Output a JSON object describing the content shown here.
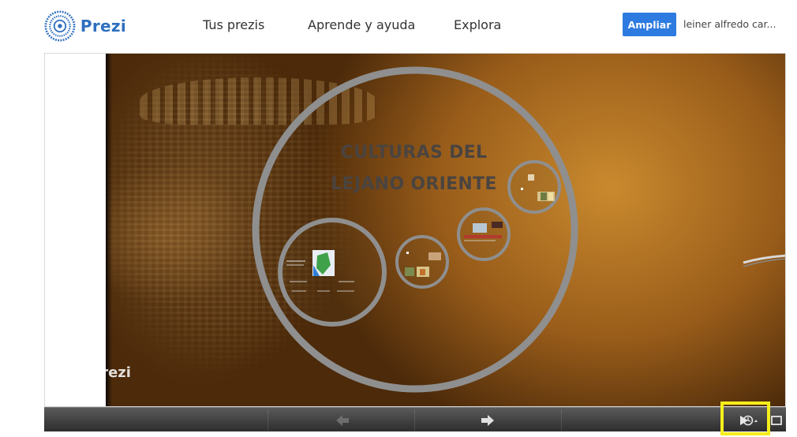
{
  "header": {
    "logo_text": "Prezi",
    "nav": [
      {
        "label": "Tus prezis"
      },
      {
        "label": "Aprende y ayuda"
      },
      {
        "label": "Explora"
      }
    ],
    "upgrade_label": "Ampliar",
    "user_name": "leiner alfredo car...",
    "brand_color": "#2e6fbf",
    "upgrade_color": "#2d7be0"
  },
  "presentation": {
    "title_line1": "CULTURAS DEL",
    "title_line2": "LEJANO ORIENTE",
    "watermark_text": "Prezi"
  },
  "toolbar": {
    "prev_icon": "arrow-left-icon",
    "next_icon": "arrow-right-icon",
    "autoplay_icon": "autoplay-icon",
    "fullscreen_icon": "fullscreen-icon",
    "highlight_color": "#f5ee1c"
  }
}
